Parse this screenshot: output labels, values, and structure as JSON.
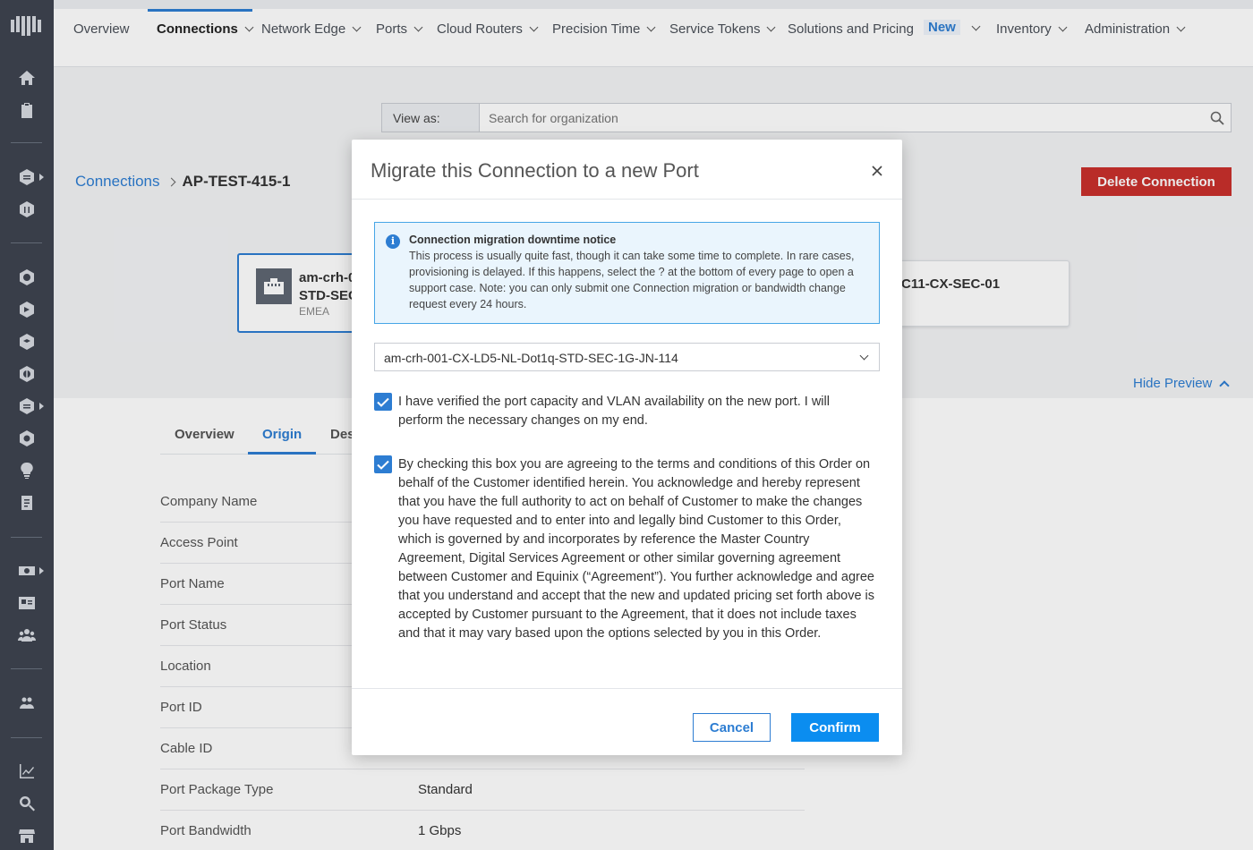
{
  "nav": {
    "items": [
      "Overview",
      "Connections",
      "Network Edge",
      "Ports",
      "Cloud Routers",
      "Precision Time",
      "Service Tokens",
      "Solutions and Pricing",
      "New",
      "Inventory",
      "Administration"
    ]
  },
  "view_as": {
    "label": "View as:",
    "placeholder": "Search for organization"
  },
  "breadcrumb": {
    "parent": "Connections",
    "current": "AP-TEST-415-1"
  },
  "delete_button": "Delete Connection",
  "preview": {
    "card_a_line1": "am-crh-0",
    "card_a_line2": "STD-SEC-",
    "card_a_region": "EMEA",
    "card_b_line1": "C11-CX-SEC-01",
    "hide_label": "Hide Preview"
  },
  "tabs": [
    "Overview",
    "Origin",
    "Des"
  ],
  "details": [
    {
      "label": "Company Name",
      "value": ""
    },
    {
      "label": "Access Point",
      "value": ""
    },
    {
      "label": "Port Name",
      "value": ""
    },
    {
      "label": "Port Status",
      "value": ""
    },
    {
      "label": "Location",
      "value": ""
    },
    {
      "label": "Port ID",
      "value": ""
    },
    {
      "label": "Cable ID",
      "value": ""
    },
    {
      "label": "Port Package Type",
      "value": "Standard"
    },
    {
      "label": "Port Bandwidth",
      "value": "1 Gbps"
    }
  ],
  "modal": {
    "title": "Migrate this Connection to a new Port",
    "notice_title": "Connection migration downtime notice",
    "notice_body": "This process is usually quite fast, though it can take some time to complete. In rare cases, provisioning is delayed. If this happens, select the ? at the bottom of every page to open a support case. Note: you can only submit one Connection migration or bandwidth change request every 24 hours.",
    "selected_port": "am-crh-001-CX-LD5-NL-Dot1q-STD-SEC-1G-JN-114",
    "check1_label": "I have verified the port capacity and VLAN availability on the new port. I will perform the necessary changes on my end.",
    "check1_checked": true,
    "check2_label": "By checking this box you are agreeing to the terms and conditions of this Order on behalf of the Customer identified herein. You acknowledge and hereby represent that you have the full authority to act on behalf of Customer to make the changes you have requested and to enter into and legally bind Customer to this Order, which is governed by and incorporates by reference the Master Country Agreement, Digital Services Agreement or other similar governing agreement between Customer and Equinix (“Agreement”). You further acknowledge and agree that you understand and accept that the new and updated pricing set forth above is accepted by Customer pursuant to the Agreement, that it does not include taxes and that it may vary based upon the options selected by you in this Order.",
    "check2_checked": true,
    "cancel_label": "Cancel",
    "confirm_label": "Confirm"
  },
  "colors": {
    "accent": "#2d7dd2",
    "danger": "#c9302c",
    "confirm": "#0b8df0",
    "rail": "#3e4450"
  }
}
